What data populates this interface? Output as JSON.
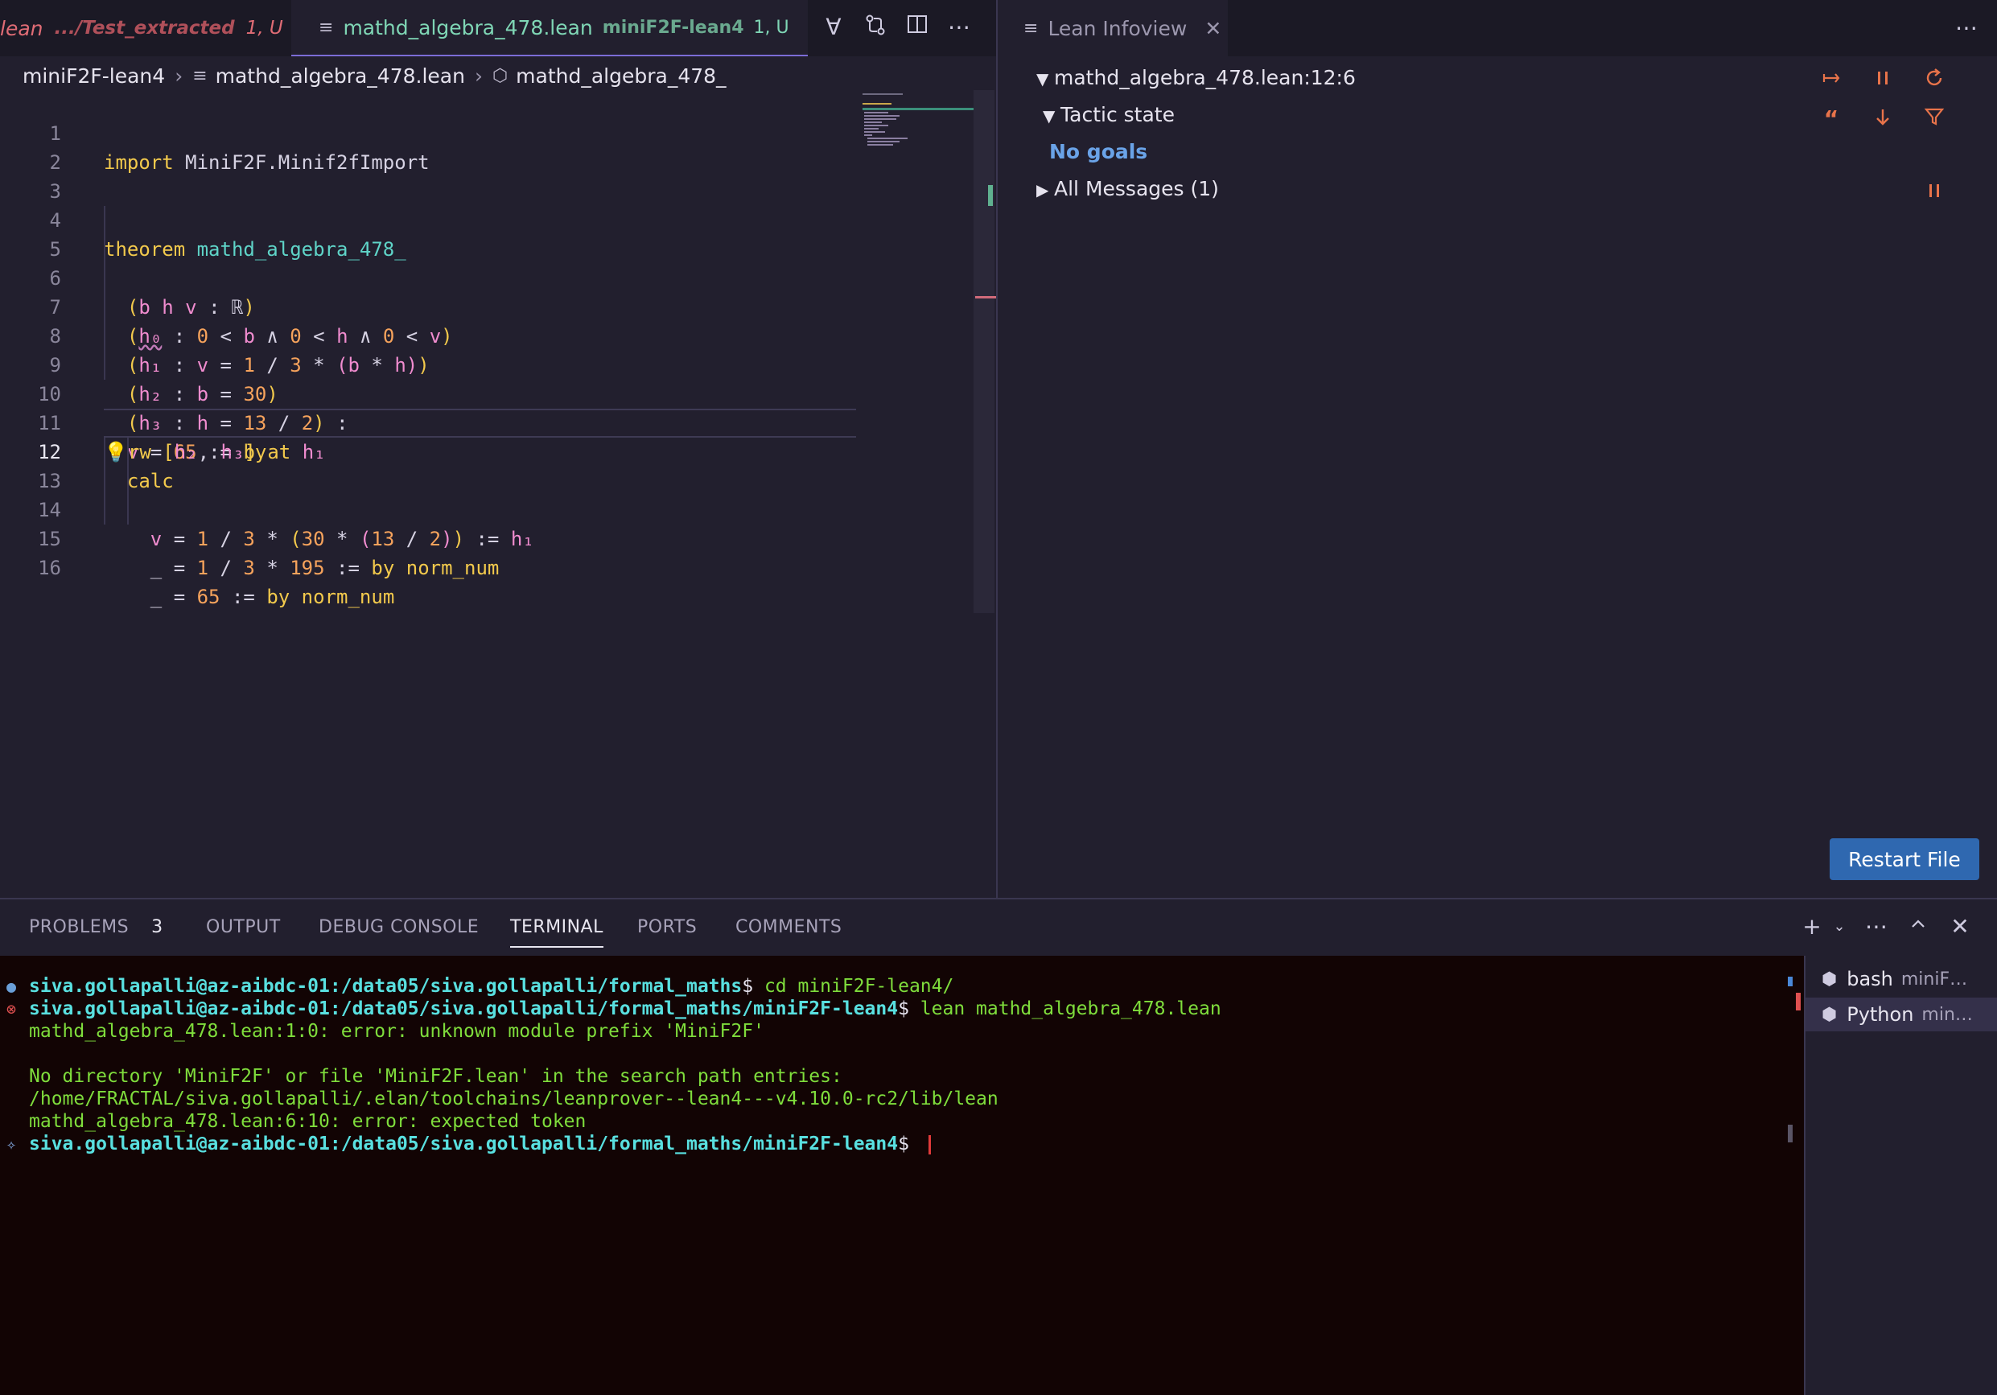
{
  "editor": {
    "tabs": [
      {
        "name": "lean",
        "path": ".../Test_extracted",
        "badge": "1, U",
        "active": false
      },
      {
        "name": "mathd_algebra_478.lean",
        "path": "miniF2F-lean4",
        "badge": "1, U",
        "active": true
      }
    ],
    "breadcrumb": {
      "folder": "miniF2F-lean4",
      "file": "mathd_algebra_478.lean",
      "symbol": "mathd_algebra_478_"
    },
    "toolbar_icons": [
      "lean-forall-icon",
      "compare-changes-icon",
      "split-editor-icon",
      "more-actions-icon"
    ],
    "current_line": 12,
    "lines": [
      {
        "n": "1",
        "text": "import MiniF2F.Minif2fImport"
      },
      {
        "n": "2",
        "text": ""
      },
      {
        "n": "3",
        "text": ""
      },
      {
        "n": "4",
        "text": "theorem mathd_algebra_478_"
      },
      {
        "n": "5",
        "text": "  (b h v : ℝ)"
      },
      {
        "n": "6",
        "text": "  (h₀ : 0 < b ∧ 0 < h ∧ 0 < v)"
      },
      {
        "n": "7",
        "text": "  (h₁ : v = 1 / 3 * (b * h))"
      },
      {
        "n": "8",
        "text": "  (h₂ : b = 30)"
      },
      {
        "n": "9",
        "text": "  (h₃ : h = 13 / 2) :"
      },
      {
        "n": "10",
        "text": "  v = 65 := by"
      },
      {
        "n": "11",
        "text": "  rw [h₂, h₃] at h₁"
      },
      {
        "n": "12",
        "text": "  calc"
      },
      {
        "n": "13",
        "text": "    v = 1 / 3 * (30 * (13 / 2)) := h₁"
      },
      {
        "n": "14",
        "text": "    _ = 1 / 3 * 195 := by norm_num"
      },
      {
        "n": "15",
        "text": "    _ = 65 := by norm_num"
      },
      {
        "n": "16",
        "text": ""
      }
    ]
  },
  "infoview": {
    "tab_label": "Lean Infoview",
    "location": "mathd_algebra_478.lean:12:6",
    "tactic_state_label": "Tactic state",
    "goals_text": "No goals",
    "all_messages_label": "All Messages (1)",
    "restart_label": "Restart File",
    "icons": [
      "pin-icon",
      "pause-icon",
      "refresh-icon",
      "quote-icon",
      "arrow-down-icon",
      "filter-icon"
    ]
  },
  "panel": {
    "tabs": [
      {
        "label": "PROBLEMS",
        "badge": "3"
      },
      {
        "label": "OUTPUT"
      },
      {
        "label": "DEBUG CONSOLE"
      },
      {
        "label": "TERMINAL",
        "active": true
      },
      {
        "label": "PORTS"
      },
      {
        "label": "COMMENTS"
      }
    ],
    "terminal": {
      "lines": [
        {
          "type": "prompt",
          "user": "siva.gollapalli@az-aibdc-01",
          "path": ":/data05/siva.gollapalli/formal_maths",
          "cmd": " cd miniF2F-lean4/"
        },
        {
          "type": "prompt",
          "user": "siva.gollapalli@az-aibdc-01",
          "path": ":/data05/siva.gollapalli/formal_maths/miniF2F-lean4",
          "cmd": " lean mathd_algebra_478.lean"
        },
        {
          "type": "out",
          "text": "mathd_algebra_478.lean:1:0: error: unknown module prefix 'MiniF2F'"
        },
        {
          "type": "out",
          "text": ""
        },
        {
          "type": "out",
          "text": "No directory 'MiniF2F' or file 'MiniF2F.lean' in the search path entries:"
        },
        {
          "type": "out",
          "text": "/home/FRACTAL/siva.gollapalli/.elan/toolchains/leanprover--lean4---v4.10.0-rc2/lib/lean"
        },
        {
          "type": "out",
          "text": "mathd_algebra_478.lean:6:10: error: expected token"
        },
        {
          "type": "prompt",
          "user": "siva.gollapalli@az-aibdc-01",
          "path": ":/data05/siva.gollapalli/formal_maths/miniF2F-lean4",
          "cmd": " "
        }
      ]
    },
    "terminal_list": [
      {
        "name": "bash",
        "sub": "miniF…"
      },
      {
        "name": "Python",
        "sub": "min…"
      }
    ],
    "colors": {
      "terminal_bg": "#120404",
      "prompt": "#59e0e0",
      "output": "#7fdd3c"
    }
  }
}
